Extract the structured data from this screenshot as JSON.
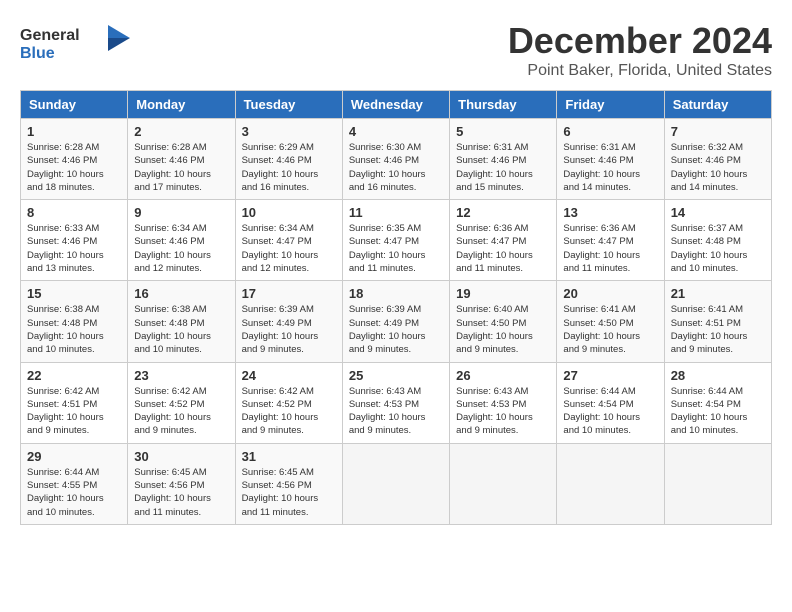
{
  "header": {
    "logo_line1": "General",
    "logo_line2": "Blue",
    "month_year": "December 2024",
    "location": "Point Baker, Florida, United States"
  },
  "days_of_week": [
    "Sunday",
    "Monday",
    "Tuesday",
    "Wednesday",
    "Thursday",
    "Friday",
    "Saturday"
  ],
  "weeks": [
    [
      {
        "day": "1",
        "sunrise": "Sunrise: 6:28 AM",
        "sunset": "Sunset: 4:46 PM",
        "daylight": "Daylight: 10 hours and 18 minutes."
      },
      {
        "day": "2",
        "sunrise": "Sunrise: 6:28 AM",
        "sunset": "Sunset: 4:46 PM",
        "daylight": "Daylight: 10 hours and 17 minutes."
      },
      {
        "day": "3",
        "sunrise": "Sunrise: 6:29 AM",
        "sunset": "Sunset: 4:46 PM",
        "daylight": "Daylight: 10 hours and 16 minutes."
      },
      {
        "day": "4",
        "sunrise": "Sunrise: 6:30 AM",
        "sunset": "Sunset: 4:46 PM",
        "daylight": "Daylight: 10 hours and 16 minutes."
      },
      {
        "day": "5",
        "sunrise": "Sunrise: 6:31 AM",
        "sunset": "Sunset: 4:46 PM",
        "daylight": "Daylight: 10 hours and 15 minutes."
      },
      {
        "day": "6",
        "sunrise": "Sunrise: 6:31 AM",
        "sunset": "Sunset: 4:46 PM",
        "daylight": "Daylight: 10 hours and 14 minutes."
      },
      {
        "day": "7",
        "sunrise": "Sunrise: 6:32 AM",
        "sunset": "Sunset: 4:46 PM",
        "daylight": "Daylight: 10 hours and 14 minutes."
      }
    ],
    [
      {
        "day": "8",
        "sunrise": "Sunrise: 6:33 AM",
        "sunset": "Sunset: 4:46 PM",
        "daylight": "Daylight: 10 hours and 13 minutes."
      },
      {
        "day": "9",
        "sunrise": "Sunrise: 6:34 AM",
        "sunset": "Sunset: 4:46 PM",
        "daylight": "Daylight: 10 hours and 12 minutes."
      },
      {
        "day": "10",
        "sunrise": "Sunrise: 6:34 AM",
        "sunset": "Sunset: 4:47 PM",
        "daylight": "Daylight: 10 hours and 12 minutes."
      },
      {
        "day": "11",
        "sunrise": "Sunrise: 6:35 AM",
        "sunset": "Sunset: 4:47 PM",
        "daylight": "Daylight: 10 hours and 11 minutes."
      },
      {
        "day": "12",
        "sunrise": "Sunrise: 6:36 AM",
        "sunset": "Sunset: 4:47 PM",
        "daylight": "Daylight: 10 hours and 11 minutes."
      },
      {
        "day": "13",
        "sunrise": "Sunrise: 6:36 AM",
        "sunset": "Sunset: 4:47 PM",
        "daylight": "Daylight: 10 hours and 11 minutes."
      },
      {
        "day": "14",
        "sunrise": "Sunrise: 6:37 AM",
        "sunset": "Sunset: 4:48 PM",
        "daylight": "Daylight: 10 hours and 10 minutes."
      }
    ],
    [
      {
        "day": "15",
        "sunrise": "Sunrise: 6:38 AM",
        "sunset": "Sunset: 4:48 PM",
        "daylight": "Daylight: 10 hours and 10 minutes."
      },
      {
        "day": "16",
        "sunrise": "Sunrise: 6:38 AM",
        "sunset": "Sunset: 4:48 PM",
        "daylight": "Daylight: 10 hours and 10 minutes."
      },
      {
        "day": "17",
        "sunrise": "Sunrise: 6:39 AM",
        "sunset": "Sunset: 4:49 PM",
        "daylight": "Daylight: 10 hours and 9 minutes."
      },
      {
        "day": "18",
        "sunrise": "Sunrise: 6:39 AM",
        "sunset": "Sunset: 4:49 PM",
        "daylight": "Daylight: 10 hours and 9 minutes."
      },
      {
        "day": "19",
        "sunrise": "Sunrise: 6:40 AM",
        "sunset": "Sunset: 4:50 PM",
        "daylight": "Daylight: 10 hours and 9 minutes."
      },
      {
        "day": "20",
        "sunrise": "Sunrise: 6:41 AM",
        "sunset": "Sunset: 4:50 PM",
        "daylight": "Daylight: 10 hours and 9 minutes."
      },
      {
        "day": "21",
        "sunrise": "Sunrise: 6:41 AM",
        "sunset": "Sunset: 4:51 PM",
        "daylight": "Daylight: 10 hours and 9 minutes."
      }
    ],
    [
      {
        "day": "22",
        "sunrise": "Sunrise: 6:42 AM",
        "sunset": "Sunset: 4:51 PM",
        "daylight": "Daylight: 10 hours and 9 minutes."
      },
      {
        "day": "23",
        "sunrise": "Sunrise: 6:42 AM",
        "sunset": "Sunset: 4:52 PM",
        "daylight": "Daylight: 10 hours and 9 minutes."
      },
      {
        "day": "24",
        "sunrise": "Sunrise: 6:42 AM",
        "sunset": "Sunset: 4:52 PM",
        "daylight": "Daylight: 10 hours and 9 minutes."
      },
      {
        "day": "25",
        "sunrise": "Sunrise: 6:43 AM",
        "sunset": "Sunset: 4:53 PM",
        "daylight": "Daylight: 10 hours and 9 minutes."
      },
      {
        "day": "26",
        "sunrise": "Sunrise: 6:43 AM",
        "sunset": "Sunset: 4:53 PM",
        "daylight": "Daylight: 10 hours and 9 minutes."
      },
      {
        "day": "27",
        "sunrise": "Sunrise: 6:44 AM",
        "sunset": "Sunset: 4:54 PM",
        "daylight": "Daylight: 10 hours and 10 minutes."
      },
      {
        "day": "28",
        "sunrise": "Sunrise: 6:44 AM",
        "sunset": "Sunset: 4:54 PM",
        "daylight": "Daylight: 10 hours and 10 minutes."
      }
    ],
    [
      {
        "day": "29",
        "sunrise": "Sunrise: 6:44 AM",
        "sunset": "Sunset: 4:55 PM",
        "daylight": "Daylight: 10 hours and 10 minutes."
      },
      {
        "day": "30",
        "sunrise": "Sunrise: 6:45 AM",
        "sunset": "Sunset: 4:56 PM",
        "daylight": "Daylight: 10 hours and 11 minutes."
      },
      {
        "day": "31",
        "sunrise": "Sunrise: 6:45 AM",
        "sunset": "Sunset: 4:56 PM",
        "daylight": "Daylight: 10 hours and 11 minutes."
      },
      {
        "day": "",
        "sunrise": "",
        "sunset": "",
        "daylight": ""
      },
      {
        "day": "",
        "sunrise": "",
        "sunset": "",
        "daylight": ""
      },
      {
        "day": "",
        "sunrise": "",
        "sunset": "",
        "daylight": ""
      },
      {
        "day": "",
        "sunrise": "",
        "sunset": "",
        "daylight": ""
      }
    ]
  ]
}
